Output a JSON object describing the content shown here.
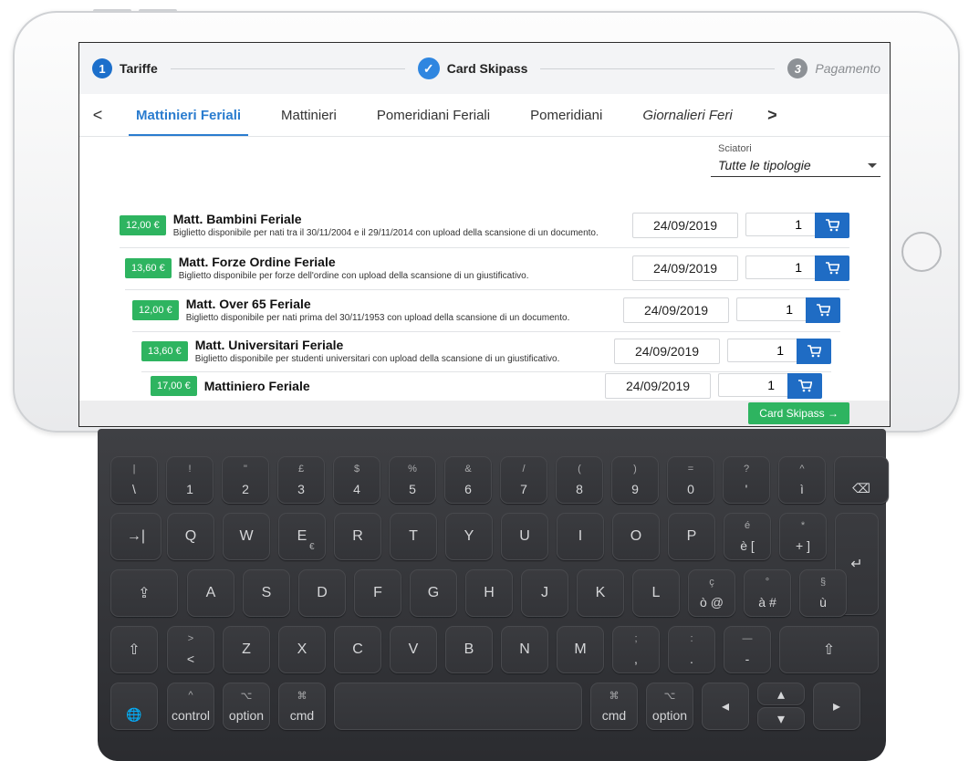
{
  "stepper": {
    "steps": [
      {
        "num": "1",
        "label": "Tariffe"
      },
      {
        "label": "Card Skipass"
      },
      {
        "num": "3",
        "label": "Pagamento"
      }
    ]
  },
  "tabs": {
    "items": [
      "Mattinieri Feriali",
      "Mattinieri",
      "Pomeridiani Feriali",
      "Pomeridiani",
      "Giornalieri Feri"
    ],
    "prev": "<",
    "next": ">"
  },
  "filter": {
    "label": "Sciatori",
    "value": "Tutte le tipologie"
  },
  "tickets": [
    {
      "price": "12,00 €",
      "title": "Matt. Bambini Feriale",
      "desc": "Biglietto disponibile per nati tra il 30/11/2004 e il 29/11/2014 con upload della scansione di un documento.",
      "date": "24/09/2019",
      "qty": "1"
    },
    {
      "price": "13,60 €",
      "title": "Matt. Forze Ordine Feriale",
      "desc": "Biglietto disponibile per forze dell'ordine con upload della scansione di un giustificativo.",
      "date": "24/09/2019",
      "qty": "1"
    },
    {
      "price": "12,00 €",
      "title": "Matt. Over 65 Feriale",
      "desc": "Biglietto disponibile per nati prima del 30/11/1953 con upload della scansione di un documento.",
      "date": "24/09/2019",
      "qty": "1"
    },
    {
      "price": "13,60 €",
      "title": "Matt. Universitari Feriale",
      "desc": "Biglietto disponibile per studenti universitari con upload della scansione di un giustificativo.",
      "date": "24/09/2019",
      "qty": "1"
    },
    {
      "price": "17,00 €",
      "title": "Mattiniero Feriale",
      "desc": "",
      "date": "24/09/2019",
      "qty": "1"
    }
  ],
  "footer": {
    "cta": "Card Skipass →"
  },
  "keyboard": {
    "row1": [
      {
        "top": "|",
        "bot": "\\"
      },
      {
        "top": "!",
        "bot": "1"
      },
      {
        "top": "\"",
        "bot": "2"
      },
      {
        "top": "£",
        "bot": "3"
      },
      {
        "top": "$",
        "bot": "4"
      },
      {
        "top": "%",
        "bot": "5"
      },
      {
        "top": "&",
        "bot": "6"
      },
      {
        "top": "/",
        "bot": "7"
      },
      {
        "top": "(",
        "bot": "8"
      },
      {
        "top": ")",
        "bot": "9"
      },
      {
        "top": "=",
        "bot": "0"
      },
      {
        "top": "?",
        "bot": "'"
      },
      {
        "top": "^",
        "bot": "ì"
      },
      {
        "top": "",
        "bot": "⌫"
      }
    ],
    "row2": [
      "→|",
      "Q",
      "W",
      "E",
      "R",
      "T",
      "Y",
      "U",
      "I",
      "O",
      "P"
    ],
    "row2_extra": [
      {
        "top": "é",
        "bot": "è ["
      },
      {
        "top": "*",
        "bot": "+ ]"
      }
    ],
    "row3": [
      "⇪",
      "A",
      "S",
      "D",
      "F",
      "G",
      "H",
      "J",
      "K",
      "L"
    ],
    "row3_extra": [
      {
        "top": "ç",
        "bot": "ò @"
      },
      {
        "top": "°",
        "bot": "à #"
      },
      {
        "top": "§",
        "bot": "ù"
      }
    ],
    "row4": [
      "⇧",
      "Z",
      "X",
      "C",
      "V",
      "B",
      "N",
      "M"
    ],
    "row4_extra": [
      {
        "top": ">",
        "bot": "<"
      },
      {
        "top": ";",
        "bot": ","
      },
      {
        "top": ":",
        "bot": "."
      },
      {
        "top": "—",
        "bot": "-"
      }
    ],
    "row4_shift_r": "⇧",
    "row5": [
      {
        "top": "",
        "bot": "🌐"
      },
      {
        "top": "^",
        "bot": "control"
      },
      {
        "top": "⌥",
        "bot": "option"
      },
      {
        "top": "⌘",
        "bot": "cmd"
      },
      {
        "top": "⌘",
        "bot": "cmd"
      },
      {
        "top": "⌥",
        "bot": "option"
      }
    ],
    "arrows": {
      "left": "◂",
      "up": "▴",
      "down": "▾",
      "right": "▸"
    },
    "enter": "↵",
    "e_sub": "€"
  }
}
